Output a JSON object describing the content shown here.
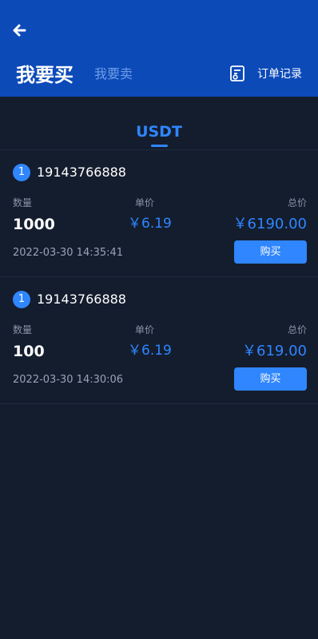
{
  "header": {
    "title": "我要买",
    "subtitle": "我要卖",
    "orders_label": "订单记录"
  },
  "tabs": [
    {
      "label": "USDT",
      "active": true
    }
  ],
  "labels": {
    "quantity": "数量",
    "unit_price": "单价",
    "total": "总价",
    "buy": "购买"
  },
  "listings": [
    {
      "badge": "1",
      "phone": "19143766888",
      "quantity": "1000",
      "unit_price": "￥6.19",
      "total": "￥6190.00",
      "time": "2022-03-30 14:35:41"
    },
    {
      "badge": "1",
      "phone": "19143766888",
      "quantity": "100",
      "unit_price": "￥6.19",
      "total": "￥619.00",
      "time": "2022-03-30 14:30:06"
    }
  ],
  "colors": {
    "header_bg": "#0c4ab8",
    "page_bg": "#141d2e",
    "accent": "#2f86ff",
    "muted": "#8a93a6"
  }
}
